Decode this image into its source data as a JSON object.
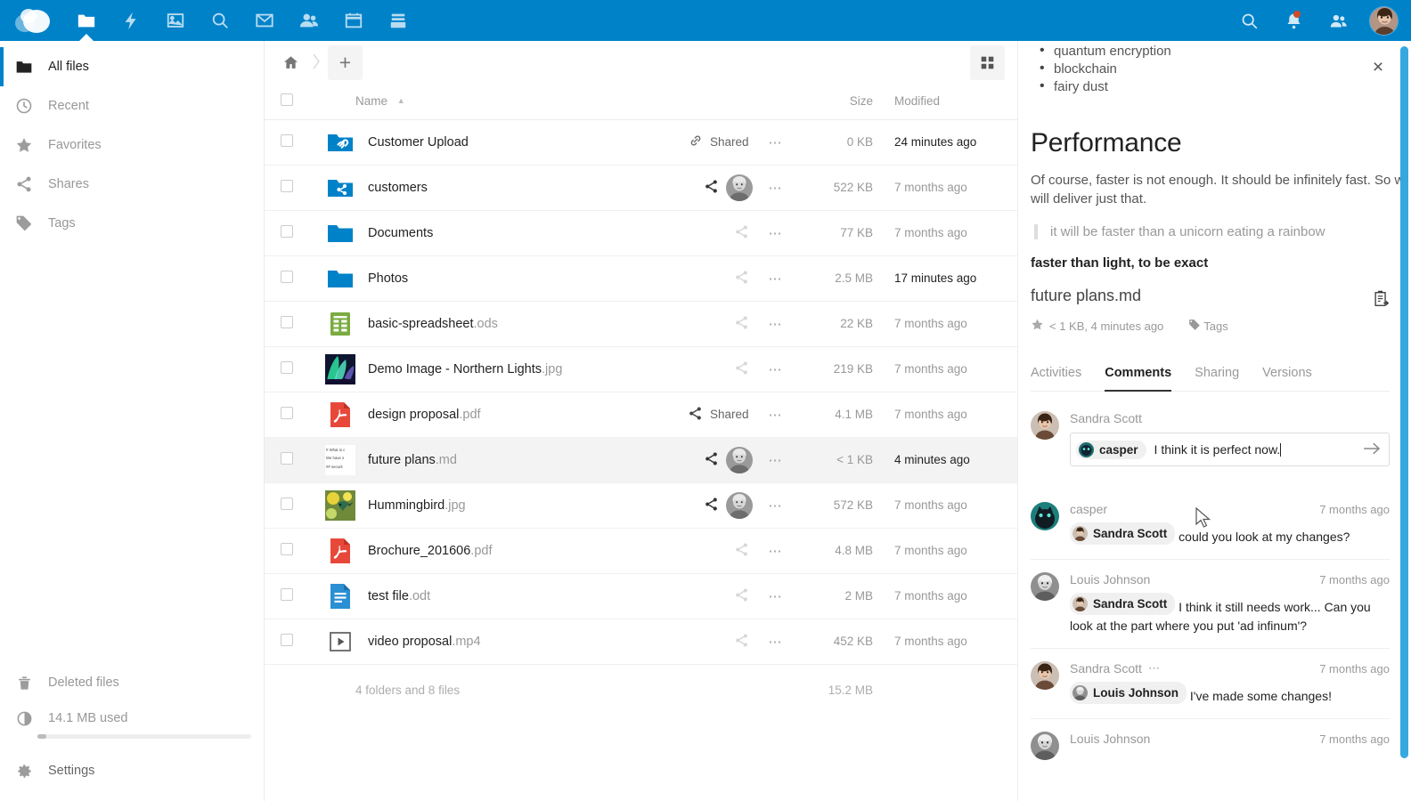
{
  "header": {
    "logo_name": "nextcloud-logo",
    "accent_color": "#0082c9",
    "apps": [
      {
        "id": "files",
        "label": "Files",
        "icon": "folder-icon",
        "active": true
      },
      {
        "id": "activity",
        "label": "Activity",
        "icon": "lightning-icon",
        "active": false
      },
      {
        "id": "photos",
        "label": "Photos",
        "icon": "picture-icon",
        "active": false
      },
      {
        "id": "search",
        "label": "Search",
        "icon": "magnifier-icon",
        "active": false
      },
      {
        "id": "mail",
        "label": "Mail",
        "icon": "envelope-icon",
        "active": false
      },
      {
        "id": "contacts",
        "label": "Contacts",
        "icon": "people-icon",
        "active": false
      },
      {
        "id": "calendar",
        "label": "Calendar",
        "icon": "calendar-icon",
        "active": false
      },
      {
        "id": "deck",
        "label": "Deck",
        "icon": "archive-icon",
        "active": false
      }
    ],
    "right": [
      {
        "id": "search",
        "label": "Search",
        "icon": "search-icon"
      },
      {
        "id": "notifications",
        "label": "Notifications",
        "icon": "bell-icon",
        "badge": true
      },
      {
        "id": "contacts-menu",
        "label": "Contacts",
        "icon": "contacts-icon"
      }
    ],
    "avatar_alt": "Sandra Scott"
  },
  "sidebar": {
    "items": [
      {
        "label": "All files",
        "icon": "folder-icon",
        "active": true
      },
      {
        "label": "Recent",
        "icon": "clock-icon",
        "active": false
      },
      {
        "label": "Favorites",
        "icon": "star-icon",
        "active": false
      },
      {
        "label": "Shares",
        "icon": "share-icon",
        "active": false
      },
      {
        "label": "Tags",
        "icon": "tag-icon",
        "active": false
      }
    ],
    "bottom": [
      {
        "label": "Deleted files",
        "icon": "trash-icon"
      },
      {
        "label": "14.1 MB used",
        "icon": "quota-icon"
      },
      {
        "label": "Settings",
        "icon": "gear-icon"
      }
    ],
    "quota_percent": 4
  },
  "toolbar": {
    "home_label": "Home",
    "new_label": "+",
    "view_toggle_label": "Switch to grid view"
  },
  "filelist": {
    "columns": {
      "name": "Name",
      "size": "Size",
      "modified": "Modified"
    },
    "sort": "asc",
    "rows": [
      {
        "name": "Customer Upload",
        "ext": "",
        "icon": "folder-link-icon",
        "share_kind": "link-shared",
        "share_label": "Shared",
        "avatar": null,
        "size": "0 KB",
        "modified": "24 minutes ago",
        "recent": true,
        "selected": false
      },
      {
        "name": "customers",
        "ext": "",
        "icon": "folder-share-icon",
        "share_kind": "avatar",
        "share_label": "",
        "avatar": "louis",
        "size": "522 KB",
        "modified": "7 months ago",
        "recent": false,
        "selected": false
      },
      {
        "name": "Documents",
        "ext": "",
        "icon": "folder-icon",
        "share_kind": "none",
        "share_label": "",
        "avatar": null,
        "size": "77 KB",
        "modified": "7 months ago",
        "recent": false,
        "selected": false
      },
      {
        "name": "Photos",
        "ext": "",
        "icon": "folder-icon",
        "share_kind": "none",
        "share_label": "",
        "avatar": null,
        "size": "2.5 MB",
        "modified": "17 minutes ago",
        "recent": true,
        "selected": false
      },
      {
        "name": "basic-spreadsheet",
        "ext": ".ods",
        "icon": "spreadsheet-icon",
        "share_kind": "none",
        "share_label": "",
        "avatar": null,
        "size": "22 KB",
        "modified": "7 months ago",
        "recent": false,
        "selected": false
      },
      {
        "name": "Demo Image - Northern Lights",
        "ext": ".jpg",
        "icon": "thumb-aurora",
        "share_kind": "none",
        "share_label": "",
        "avatar": null,
        "size": "219 KB",
        "modified": "7 months ago",
        "recent": false,
        "selected": false
      },
      {
        "name": "design proposal",
        "ext": ".pdf",
        "icon": "pdf-icon",
        "share_kind": "shared",
        "share_label": "Shared",
        "avatar": null,
        "size": "4.1 MB",
        "modified": "7 months ago",
        "recent": false,
        "selected": false
      },
      {
        "name": "future plans",
        "ext": ".md",
        "icon": "thumb-markdown",
        "share_kind": "avatar",
        "share_label": "",
        "avatar": "louis",
        "size": "< 1 KB",
        "modified": "4 minutes ago",
        "recent": true,
        "selected": true
      },
      {
        "name": "Hummingbird",
        "ext": ".jpg",
        "icon": "thumb-hummingbird",
        "share_kind": "avatar",
        "share_label": "",
        "avatar": "louis",
        "size": "572 KB",
        "modified": "7 months ago",
        "recent": false,
        "selected": false
      },
      {
        "name": "Brochure_201606",
        "ext": ".pdf",
        "icon": "pdf-icon",
        "share_kind": "none",
        "share_label": "",
        "avatar": null,
        "size": "4.8 MB",
        "modified": "7 months ago",
        "recent": false,
        "selected": false
      },
      {
        "name": "test file",
        "ext": ".odt",
        "icon": "document-icon",
        "share_kind": "none",
        "share_label": "",
        "avatar": null,
        "size": "2 MB",
        "modified": "7 months ago",
        "recent": false,
        "selected": false
      },
      {
        "name": "video proposal",
        "ext": ".mp4",
        "icon": "video-icon",
        "share_kind": "none",
        "share_label": "",
        "avatar": null,
        "size": "452 KB",
        "modified": "7 months ago",
        "recent": false,
        "selected": false
      }
    ],
    "summary_count": "4 folders and 8 files",
    "summary_size": "15.2 MB"
  },
  "details": {
    "preview": {
      "bullets": [
        "quantum encryption",
        "blockchain",
        "fairy dust"
      ],
      "heading": "Performance",
      "paragraph": "Of course, faster is not enough. It should be infinitely fast. So we will deliver just that.",
      "paragraph_line1": "Of course, faster is not enough. It should be infinitely fast. So we",
      "paragraph_line2": "will deliver just that.",
      "quote": "it will be faster than a unicorn eating a rainbow",
      "bold_line": "faster than light, to be exact"
    },
    "file": {
      "name": "future plans.md",
      "meta": "< 1 KB, 4 minutes ago",
      "tags_label": "Tags",
      "favorite": true
    },
    "close_label": "×",
    "tabs": [
      {
        "label": "Activities",
        "active": false
      },
      {
        "label": "Comments",
        "active": true
      },
      {
        "label": "Sharing",
        "active": false
      },
      {
        "label": "Versions",
        "active": false
      }
    ],
    "new_comment": {
      "author": "Sandra Scott",
      "mention": "casper",
      "text": "I think it is perfect now.",
      "send_label": "Submit comment"
    },
    "comments": [
      {
        "author": "casper",
        "time": "7 months ago",
        "mention": "Sandra Scott",
        "text": "could you look at my changes?",
        "menu": false
      },
      {
        "author": "Louis Johnson",
        "time": "7 months ago",
        "mention": "Sandra Scott",
        "text": "I think it still needs work... Can you look at the part where you put 'ad infinum'?",
        "menu": false
      },
      {
        "author": "Sandra Scott",
        "time": "7 months ago",
        "mention": "Louis Johnson",
        "text": "I've made some changes!",
        "menu": true
      },
      {
        "author": "Louis Johnson",
        "time": "7 months ago",
        "mention": "",
        "text": "",
        "menu": false
      }
    ]
  }
}
